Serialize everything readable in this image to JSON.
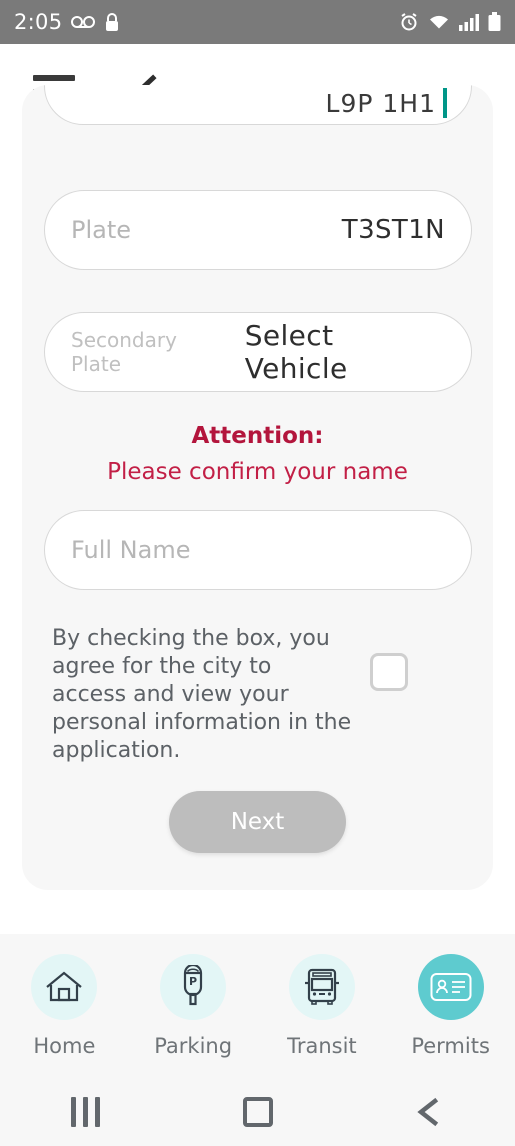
{
  "status_bar": {
    "time": "2:05",
    "left_icons": [
      "voicemail-icon",
      "lock-icon"
    ],
    "right_icons": [
      "alarm-icon",
      "wifi-icon",
      "signal-icon",
      "battery-icon"
    ]
  },
  "header": {
    "menu_icon": "hamburger-menu-icon",
    "back_icon": "back-chevron-icon"
  },
  "form": {
    "clipped_field": {
      "value": "L9P 1H1"
    },
    "plate_field": {
      "placeholder": "Plate",
      "value": "T3ST1N"
    },
    "secondary_plate_field": {
      "placeholder": "Secondary Plate",
      "value": "Select Vehicle"
    },
    "attention": {
      "title": "Attention:",
      "message": "Please confirm your name",
      "color": "#c21f46"
    },
    "full_name_field": {
      "placeholder": "Full Name",
      "value": ""
    },
    "consent": {
      "text": "By checking the box, you agree for the city to access and view your personal information in the application.",
      "checked": false
    },
    "next_button": {
      "label": "Next",
      "enabled": false
    }
  },
  "tab_bar": {
    "active_color": "#5ecbcf",
    "inactive_color": "#e3f6f6",
    "tabs": [
      {
        "label": "Home",
        "icon": "home-icon",
        "active": false
      },
      {
        "label": "Parking",
        "icon": "parking-meter-icon",
        "active": false
      },
      {
        "label": "Transit",
        "icon": "bus-icon",
        "active": false
      },
      {
        "label": "Permits",
        "icon": "id-card-icon",
        "active": true
      }
    ]
  },
  "system_nav": {
    "recents": "recents-icon",
    "home": "home-square-icon",
    "back": "back-icon"
  }
}
